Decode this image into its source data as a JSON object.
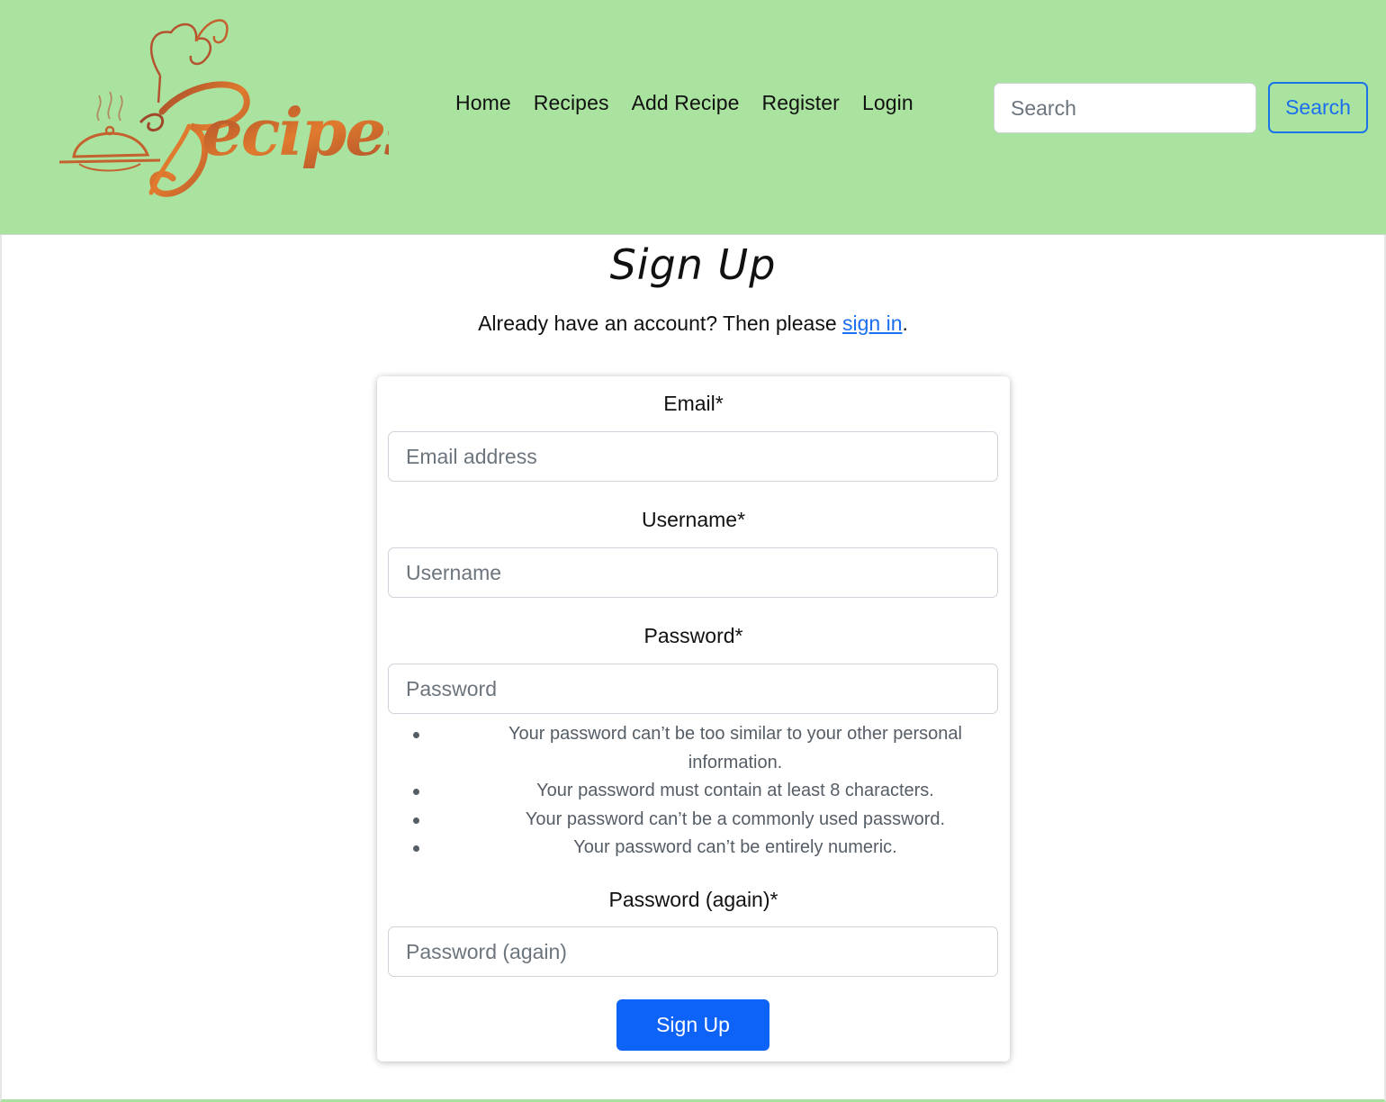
{
  "header": {
    "logo_text": "Recipes",
    "nav": [
      "Home",
      "Recipes",
      "Add Recipe",
      "Register",
      "Login"
    ],
    "search": {
      "placeholder": "Search",
      "button_label": "Search"
    }
  },
  "page": {
    "title": "Sign Up",
    "subtitle_prefix": "Already have an account? Then please ",
    "subtitle_link": "sign in",
    "subtitle_suffix": "."
  },
  "form": {
    "email": {
      "label": "Email*",
      "placeholder": "Email address"
    },
    "username": {
      "label": "Username*",
      "placeholder": "Username"
    },
    "password": {
      "label": "Password*",
      "placeholder": "Password"
    },
    "password_help": [
      "Your password can’t be too similar to your other personal information.",
      "Your password must contain at least 8 characters.",
      "Your password can’t be a commonly used password.",
      "Your password can’t be entirely numeric."
    ],
    "password_again": {
      "label": "Password (again)*",
      "placeholder": "Password (again)"
    },
    "submit_label": "Sign Up"
  },
  "colors": {
    "header_bg": "#aae39f",
    "link": "#1a6ef0",
    "primary_button": "#0d62f7",
    "logo_orange": "#e07a2e",
    "logo_brown": "#a0482a"
  },
  "icons": {
    "logo": "chef-hat-cloche-logo"
  }
}
